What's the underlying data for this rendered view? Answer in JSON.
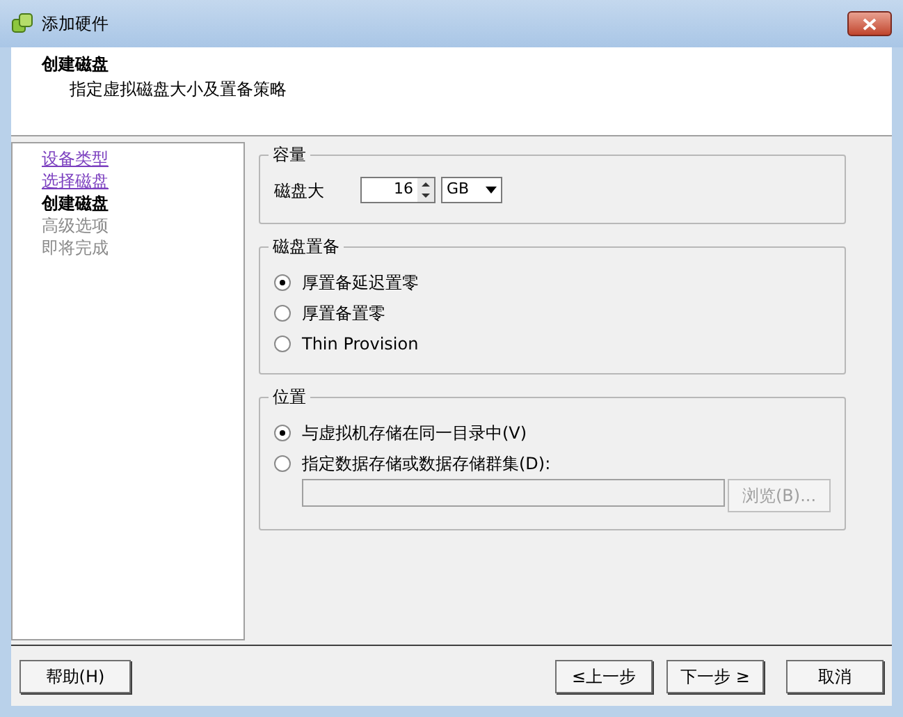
{
  "window": {
    "title": "添加硬件"
  },
  "header": {
    "title": "创建磁盘",
    "subtitle": "指定虚拟磁盘大小及置备策略"
  },
  "sidebar": {
    "items": [
      {
        "label": "设备类型",
        "kind": "visited"
      },
      {
        "label": "选择磁盘",
        "kind": "visited"
      },
      {
        "label": "创建磁盘",
        "kind": "current"
      },
      {
        "label": "高级选项",
        "kind": "pending"
      },
      {
        "label": "即将完成",
        "kind": "pending"
      }
    ]
  },
  "capacity": {
    "title": "容量",
    "label": "磁盘大",
    "value": "16",
    "unit": "GB"
  },
  "provisioning": {
    "title": "磁盘置备",
    "options": [
      {
        "label": "厚置备延迟置零",
        "selected": true
      },
      {
        "label": "厚置备置零",
        "selected": false
      },
      {
        "label": "Thin Provision",
        "selected": false
      }
    ]
  },
  "location": {
    "title": "位置",
    "options": [
      {
        "label": "与虚拟机存储在同一目录中(V)",
        "selected": true
      },
      {
        "label": "指定数据存储或数据存储群集(D):",
        "selected": false
      }
    ],
    "browse": {
      "label": "浏览(B)...",
      "disabled": true
    }
  },
  "buttons": {
    "help": "帮助(H)",
    "back": "≤上一步",
    "next": "下一步 ≥",
    "cancel": "取消"
  }
}
